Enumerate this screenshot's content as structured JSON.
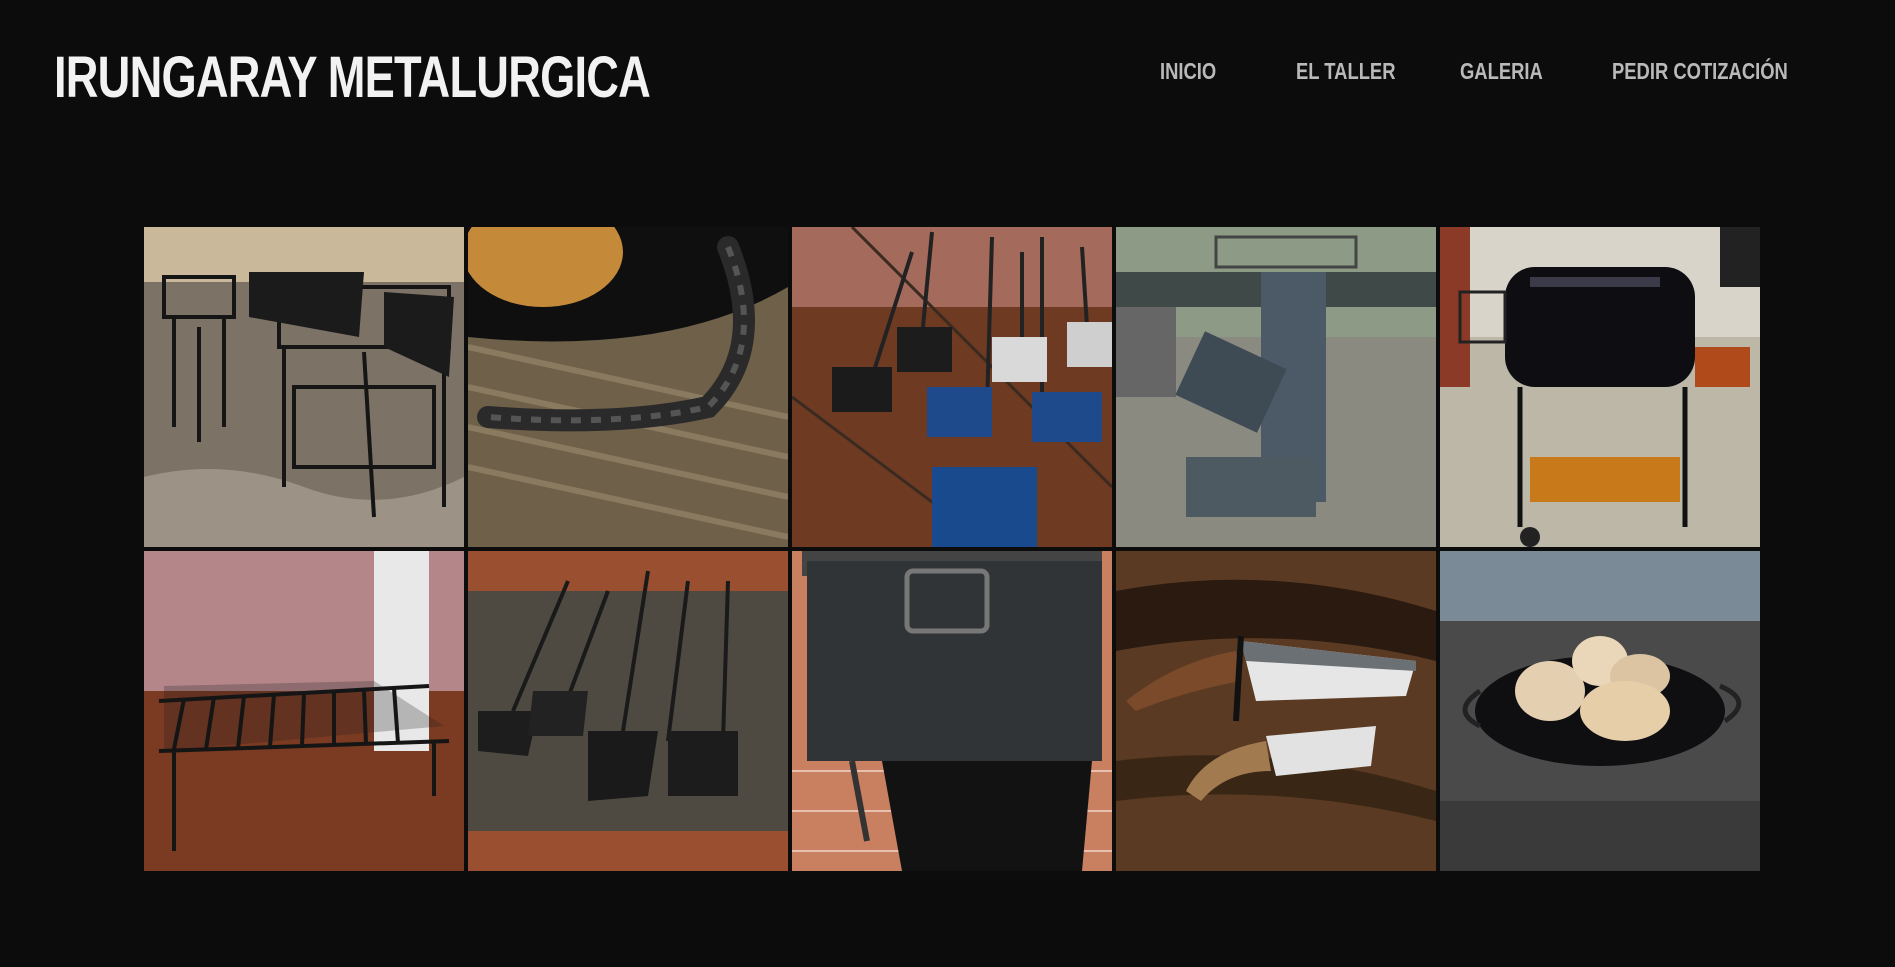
{
  "header": {
    "brand": "IRUNGARAY METALURGICA",
    "nav": [
      {
        "label": "INICIO"
      },
      {
        "label": "EL TALLER"
      },
      {
        "label": "GALERIA"
      },
      {
        "label": "PEDIR COTIZACIÓN"
      }
    ]
  },
  "gallery": {
    "items": [
      {
        "subject": "metal-grill-carts-photo"
      },
      {
        "subject": "twisted-iron-handle-pan-photo"
      },
      {
        "subject": "fireplace-shovel-set-photo"
      },
      {
        "subject": "rocket-stove-photo"
      },
      {
        "subject": "barrel-smoker-grill-photo"
      },
      {
        "subject": "iron-grill-grate-photo"
      },
      {
        "subject": "forged-shovels-photo"
      },
      {
        "subject": "metal-box-photo"
      },
      {
        "subject": "antler-handle-knives-photo"
      },
      {
        "subject": "iron-pan-with-squash-photo"
      }
    ]
  }
}
